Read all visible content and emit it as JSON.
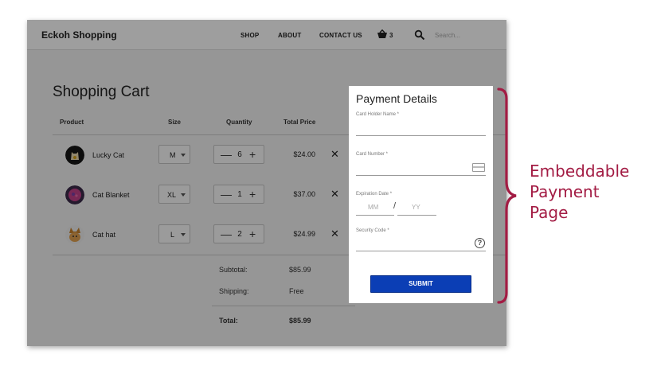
{
  "header": {
    "brand": "Eckoh Shopping",
    "nav": [
      "SHOP",
      "ABOUT",
      "CONTACT US"
    ],
    "cart_count": "3",
    "search_placeholder": "Search..."
  },
  "cart": {
    "title": "Shopping Cart",
    "columns": [
      "Product",
      "Size",
      "Quantity",
      "Total Price"
    ],
    "items": [
      {
        "name": "Lucky Cat",
        "size": "M",
        "qty": "6",
        "price": "$24.00",
        "icon": "lucky-cat-image"
      },
      {
        "name": "Cat Blanket",
        "size": "XL",
        "qty": "1",
        "price": "$37.00",
        "icon": "cat-blanket-image"
      },
      {
        "name": "Cat hat",
        "size": "L",
        "qty": "2",
        "price": "$24.99",
        "icon": "cat-hat-image"
      }
    ],
    "minus": "—",
    "plus": "+",
    "remove": "✕",
    "subtotal_label": "Subtotal:",
    "subtotal_value": "$85.99",
    "shipping_label": "Shipping:",
    "shipping_value": "Free",
    "total_label": "Total:",
    "total_value": "$85.99"
  },
  "payment": {
    "title": "Payment Details",
    "card_holder_label": "Card Holder Name *",
    "card_number_label": "Card Number *",
    "expiration_label": "Expiration Date *",
    "exp_month_placeholder": "MM",
    "exp_separator": "/",
    "exp_year_placeholder": "YY",
    "security_code_label": "Security Code *",
    "help_glyph": "?",
    "submit_label": "SUBMIT"
  },
  "annotation": {
    "lines": [
      "Embeddable",
      "Payment",
      "Page"
    ],
    "color": "#a31c44"
  },
  "colors": {
    "submit": "#0b3eb5",
    "overlay": "rgba(0,0,0,0.38)"
  }
}
